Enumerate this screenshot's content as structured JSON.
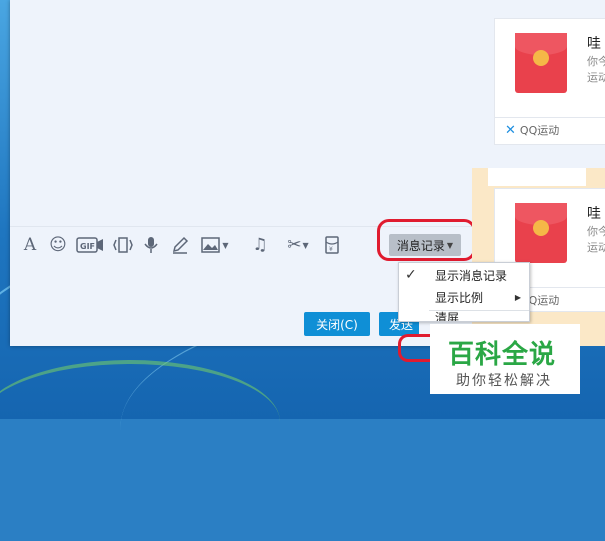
{
  "colors": {
    "accent_button": "#0f8fd6",
    "annotation_red": "#e01b2f",
    "watermark_green": "#2aa745",
    "red_packet": "#e9414c"
  },
  "toolbar": {
    "icons": [
      "font-icon",
      "emoji-icon",
      "gif-icon",
      "vibrate-icon",
      "microphone-icon",
      "pen-icon",
      "image-icon",
      "music-icon",
      "scissors-icon",
      "red-packet-icon"
    ],
    "gif_label": "GIF",
    "history_label": "消息记录"
  },
  "buttons": {
    "close_label": "关闭(C)",
    "send_label": "发送"
  },
  "context_menu": {
    "items": [
      {
        "label": "显示消息记录",
        "checked": true
      },
      {
        "label": "显示比例",
        "has_submenu": true
      }
    ],
    "partial_label": "清屏"
  },
  "cards": [
    {
      "title": "哇",
      "sub1": "你今",
      "sub2": "运动",
      "footer": "QQ运动"
    },
    {
      "title": "哇",
      "sub1": "你今",
      "sub2": "运动",
      "footer": "QQ运动"
    }
  ],
  "watermark": {
    "title": "百科全说",
    "subtitle": "助你轻松解决"
  }
}
